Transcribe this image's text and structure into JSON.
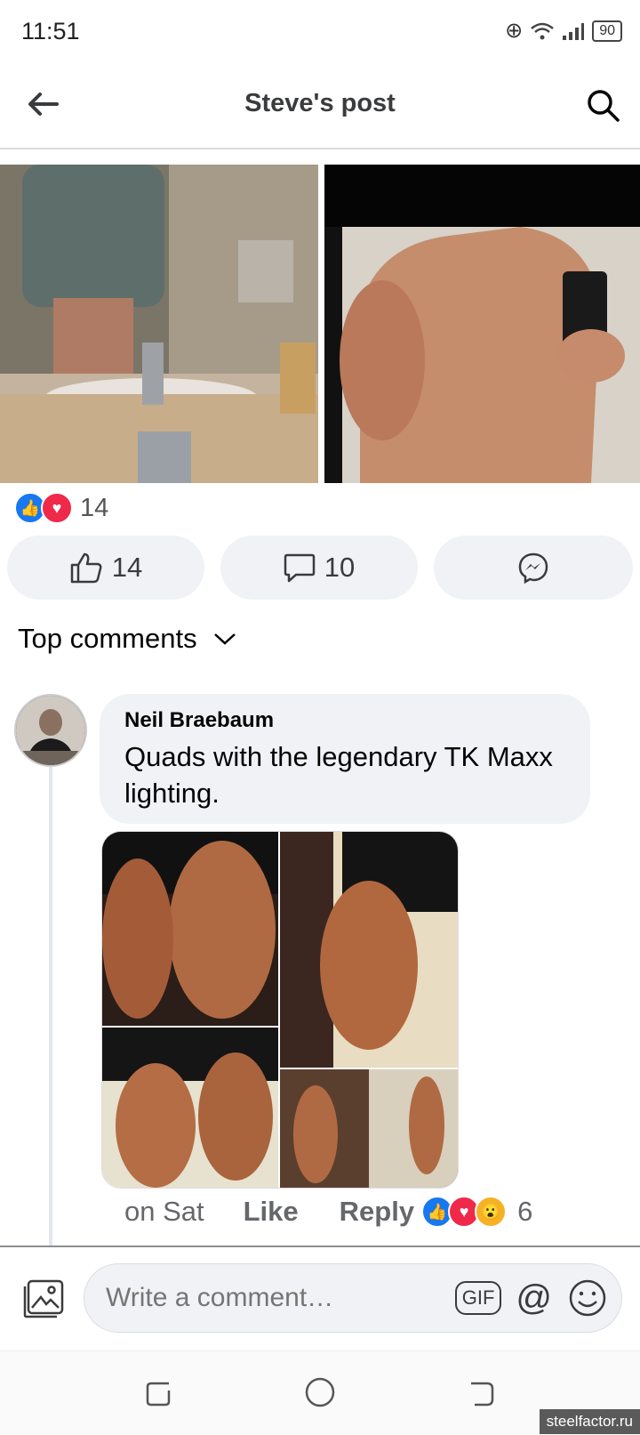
{
  "status": {
    "time": "11:51",
    "battery": "90"
  },
  "header": {
    "title": "Steve's post"
  },
  "post": {
    "reaction_count": "14",
    "like_count": "14",
    "comment_count": "10"
  },
  "comments_section": {
    "sort_label": "Top comments"
  },
  "comment": {
    "author": "Neil Braebaum",
    "text": "Quads with the legendary TK Maxx lighting.",
    "time": "on Sat",
    "like_label": "Like",
    "reply_label": "Reply",
    "reaction_count": "6"
  },
  "composer": {
    "placeholder": "Write a comment…",
    "gif_label": "GIF",
    "mention_label": "@"
  },
  "watermark": "steelfactor.ru"
}
